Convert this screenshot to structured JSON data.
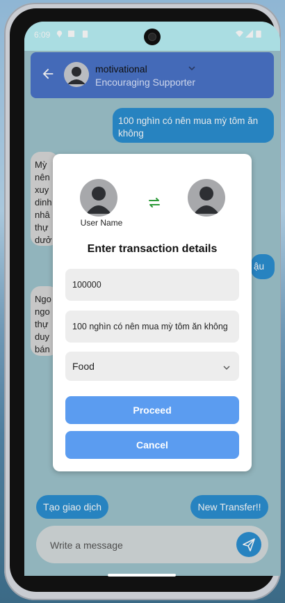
{
  "status_bar": {
    "time": "6:09"
  },
  "header": {
    "name": "motivational",
    "subtitle": "Encouraging Supporter"
  },
  "messages": [
    {
      "text": "100 nghìn có nên mua mỳ tôm ăn không"
    },
    {
      "text": "Mỳ nên xuy dinh nhâ thự dưở"
    },
    {
      "text": "ậu"
    },
    {
      "text": "Ngo ngo thự duy bán"
    }
  ],
  "quick_actions": {
    "create": "Tạo giao dịch",
    "new_transfer": "New Transfer!!"
  },
  "composer": {
    "placeholder": "Write a message"
  },
  "modal": {
    "user_label": "User Name",
    "title": "Enter transaction details",
    "amount": "100000",
    "note": "100 nghìn có nên mua mỳ tôm ăn không",
    "category": "Food",
    "proceed": "Proceed",
    "cancel": "Cancel"
  },
  "colors": {
    "accent": "#2b8fd1",
    "header": "#4a73c8",
    "button": "#5b9cf0"
  }
}
